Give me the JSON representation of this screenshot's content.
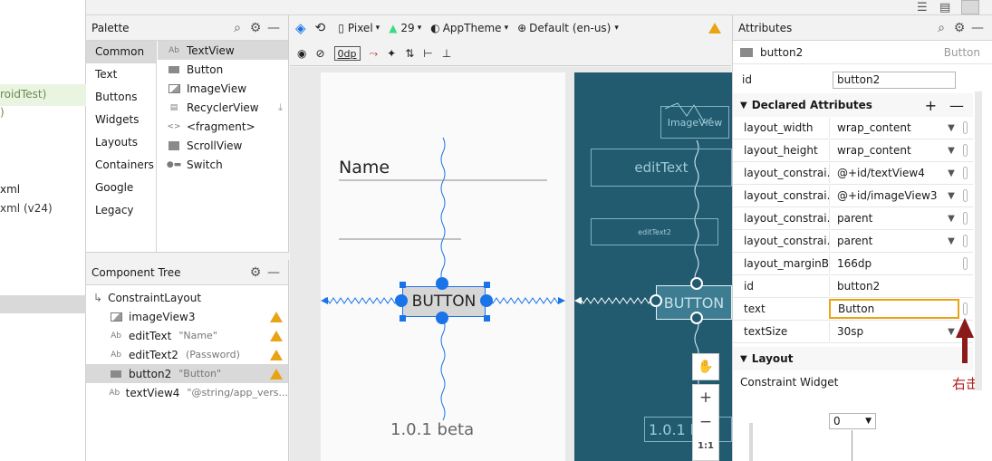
{
  "project_pane": {
    "lines": [
      "roidTest)",
      ")",
      "xml",
      "xml (v24)"
    ]
  },
  "palette": {
    "title": "Palette",
    "categories": [
      "Common",
      "Text",
      "Buttons",
      "Widgets",
      "Layouts",
      "Containers",
      "Google",
      "Legacy"
    ],
    "selected_category": "Common",
    "items": [
      {
        "icon": "textview-icon",
        "label": "TextView"
      },
      {
        "icon": "button-icon",
        "label": "Button"
      },
      {
        "icon": "image-icon",
        "label": "ImageView"
      },
      {
        "icon": "list-icon",
        "label": "RecyclerView"
      },
      {
        "icon": "fragment-icon",
        "label": "<fragment>"
      },
      {
        "icon": "scroll-icon",
        "label": "ScrollView"
      },
      {
        "icon": "switch-icon",
        "label": "Switch"
      }
    ]
  },
  "component_tree": {
    "title": "Component Tree",
    "rows": [
      {
        "label": "ConstraintLayout",
        "sub": "",
        "warn": false
      },
      {
        "label": "imageView3",
        "sub": "",
        "warn": true
      },
      {
        "label": "editText",
        "sub": "\"Name\"",
        "warn": true
      },
      {
        "label": "editText2",
        "sub": "(Password)",
        "warn": true
      },
      {
        "label": "button2",
        "sub": "\"Button\"",
        "warn": true
      },
      {
        "label": "textView4",
        "sub": "\"@string/app_vers...",
        "warn": false
      }
    ]
  },
  "toolbar": {
    "device": "Pixel",
    "api": "29",
    "theme": "AppTheme",
    "locale": "Default (en-us)",
    "margin": "0dp"
  },
  "design": {
    "name_hint": "Name",
    "button_text": "BUTTON",
    "version_text": "1.0.1 beta"
  },
  "blueprint": {
    "image_label": "ImageView",
    "edit_label": "editText",
    "edit2_label": "editText2",
    "button_label": "BUTTON",
    "version_label": "1.0.1 be"
  },
  "zoom": {
    "ratio": "1:1"
  },
  "attributes": {
    "title": "Attributes",
    "widget_name": "button2",
    "widget_type": "Button",
    "id_label": "id",
    "id_value": "button2",
    "declared_title": "Declared Attributes",
    "declared": [
      {
        "name": "layout_width",
        "value": "wrap_content",
        "dd": true
      },
      {
        "name": "layout_height",
        "value": "wrap_content",
        "dd": true
      },
      {
        "name": "layout_constrai...",
        "value": "@+id/textView4",
        "dd": true
      },
      {
        "name": "layout_constrai...",
        "value": "@+id/imageView3",
        "dd": true
      },
      {
        "name": "layout_constrai...",
        "value": "parent",
        "dd": true
      },
      {
        "name": "layout_constrai...",
        "value": "parent",
        "dd": true
      },
      {
        "name": "layout_marginB...",
        "value": "166dp",
        "dd": false
      },
      {
        "name": "id",
        "value": "button2",
        "dd": false
      },
      {
        "name": "text",
        "value": "Button",
        "dd": false
      },
      {
        "name": "textSize",
        "value": "30sp",
        "dd": true
      }
    ],
    "layout_title": "Layout",
    "constraint_widget": "Constraint Widget",
    "constraint_value": "0",
    "annotation": "右击"
  },
  "colors": {
    "accent": "#1a73e8",
    "blueprint": "#225b6f",
    "warning": "#e8a415",
    "annotation": "#8b1a1a"
  }
}
